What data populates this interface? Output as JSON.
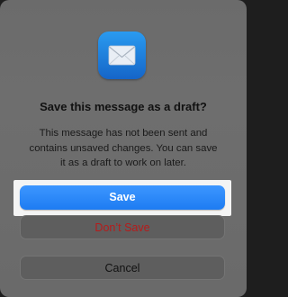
{
  "dialog": {
    "app_icon": "mail-envelope-icon",
    "title": "Save this message as a draft?",
    "message_lines": [
      "This message has not been sent and",
      "contains unsaved changes. You can save",
      "it as a draft to work on later."
    ]
  },
  "buttons": {
    "save_label": "Save",
    "dont_save_label": "Don’t Save",
    "cancel_label": "Cancel"
  },
  "colors": {
    "accent": "#1d7cf2",
    "destructive": "#b61b1b",
    "dialog_background": "#6b6b6b"
  }
}
